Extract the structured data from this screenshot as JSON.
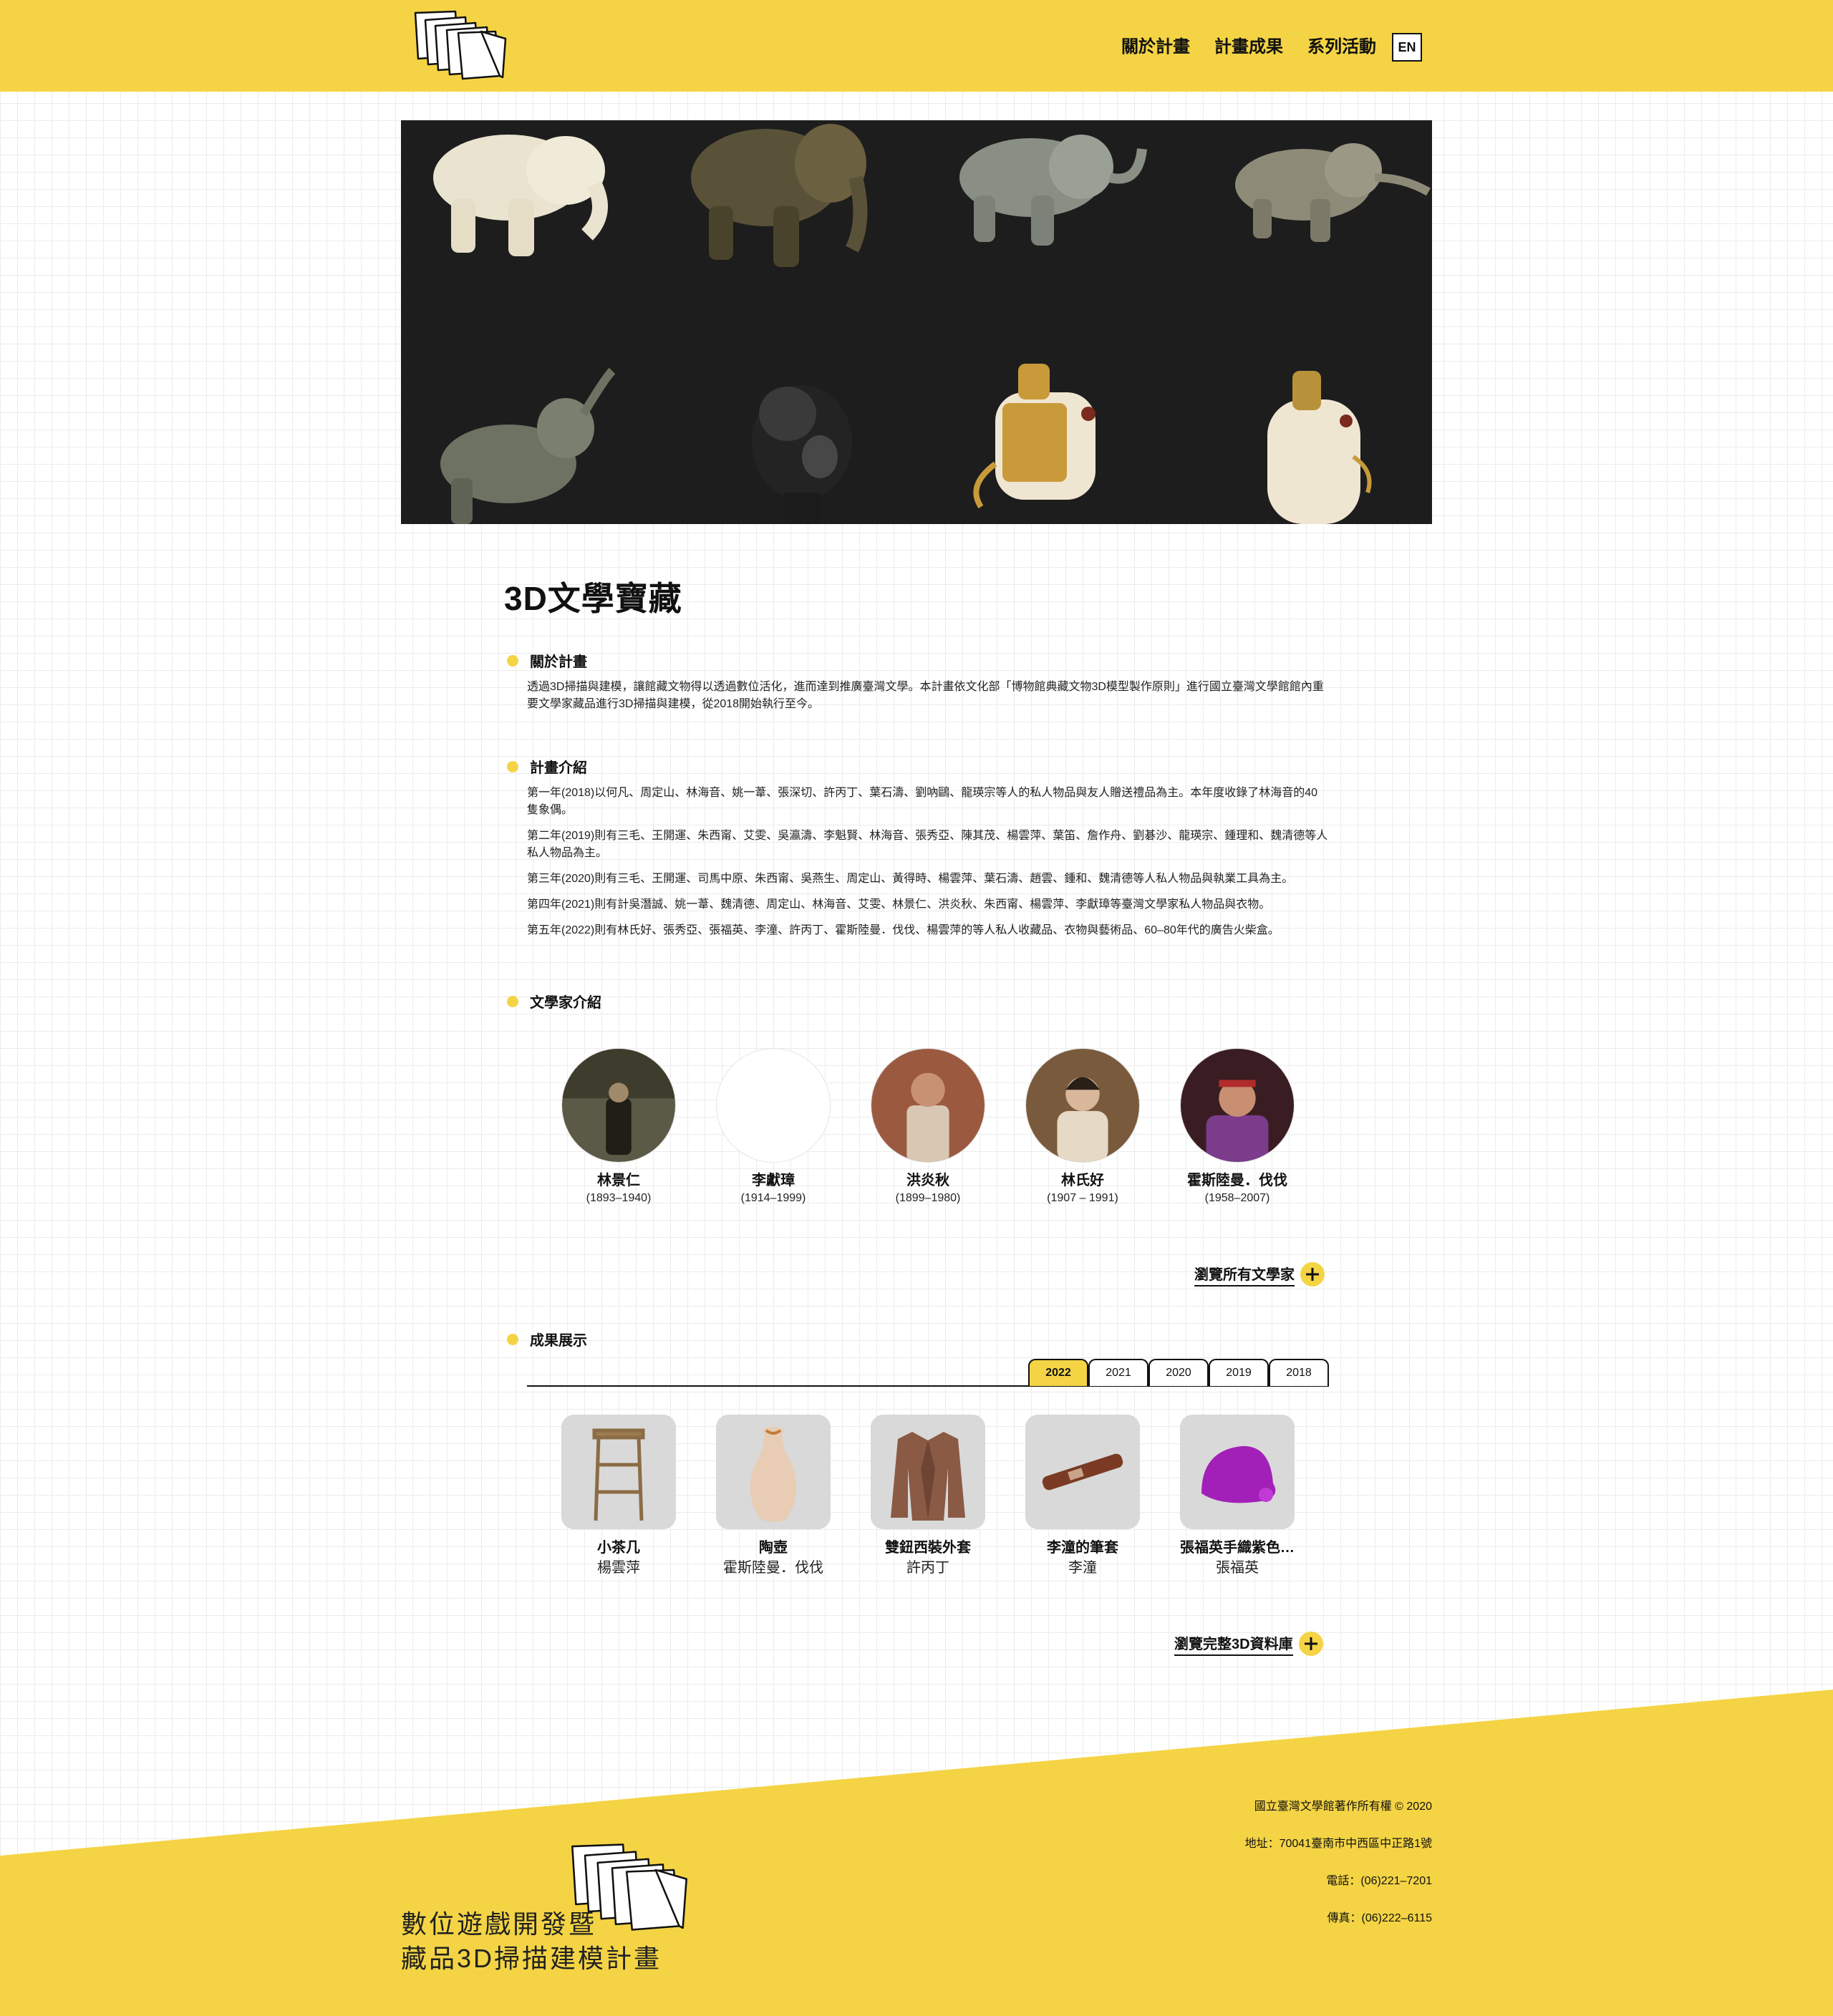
{
  "header": {
    "logo_icon": "folded-pages-logo",
    "nav": [
      "關於計畫",
      "計畫成果",
      "系列活動"
    ],
    "lang": "EN"
  },
  "hero": {
    "image": "3d-elephant-figurines-collage"
  },
  "page_title": "3D文學寶藏",
  "about": {
    "title": "關於計畫",
    "text": "透過3D掃描與建模，讓館藏文物得以透過數位活化，進而達到推廣臺灣文學。本計畫依文化部「博物館典藏文物3D模型製作原則」進行國立臺灣文學館館內重要文學家藏品進行3D掃描與建模，從2018開始執行至今。"
  },
  "intro": {
    "title": "計畫介紹",
    "paragraphs": [
      "第一年(2018)以何凡、周定山、林海音、姚一葦、張深切、許丙丁、葉石濤、劉吶鷗、龍瑛宗等人的私人物品與友人贈送禮品為主。本年度收錄了林海音的40隻象偶。",
      "第二年(2019)則有三毛、王開運、朱西甯、艾雯、吳瀛濤、李魁賢、林海音、張秀亞、陳其茂、楊雲萍、葉笛、詹作舟、劉碁沙、龍瑛宗、鍾理和、魏清德等人私人物品為主。",
      "第三年(2020)則有三毛、王開運、司馬中原、朱西甯、吳燕生、周定山、黃得時、楊雲萍、葉石濤、趙雲、鍾和、魏清德等人私人物品與執業工具為主。",
      "第四年(2021)則有計吳潛誠、姚一葦、魏清德、周定山、林海音、艾雯、林景仁、洪炎秋、朱西甯、楊雲萍、李獻璋等臺灣文學家私人物品與衣物。",
      "第五年(2022)則有林氏好、張秀亞、張福英、李潼、許丙丁、霍斯陸曼．伐伐、楊雲萍的等人私人收藏品、衣物與藝術品、60–80年代的廣告火柴盒。"
    ]
  },
  "writers": {
    "title": "文學家介紹",
    "items": [
      {
        "name": "林景仁",
        "years": "(1893–1940)"
      },
      {
        "name": "李獻璋",
        "years": "(1914–1999)"
      },
      {
        "name": "洪炎秋",
        "years": "(1899–1980)"
      },
      {
        "name": "林氏好",
        "years": "(1907 – 1991)"
      },
      {
        "name": "霍斯陸曼．伐伐",
        "years": "(1958–2007)"
      }
    ],
    "more": "瀏覽所有文學家"
  },
  "results": {
    "title": "成果展示",
    "tabs": [
      "2022",
      "2021",
      "2020",
      "2019",
      "2018"
    ],
    "active_tab": "2022",
    "items": [
      {
        "name": "小茶几",
        "author": "楊雲萍"
      },
      {
        "name": "陶壺",
        "author": "霍斯陸曼．伐伐"
      },
      {
        "name": "雙鈕西裝外套",
        "author": "許丙丁"
      },
      {
        "name": "李潼的筆套",
        "author": "李潼"
      },
      {
        "name": "張福英手織紫色…",
        "author": "張福英"
      }
    ],
    "more": "瀏覽完整3D資料庫"
  },
  "footer": {
    "copyright": "國立臺灣文學館著作所有權 © 2020",
    "address": "地址：70041臺南市中西區中正路1號",
    "phone": "電話：(06)221–7201",
    "fax": "傳真：(06)222–6115",
    "tagline_line1": "數位遊戲開發暨",
    "tagline_line2": "藏品3D掃描建模計畫"
  },
  "colors": {
    "accent": "#f4d444",
    "hero_bg": "#1d1d1d",
    "text": "#111111"
  }
}
